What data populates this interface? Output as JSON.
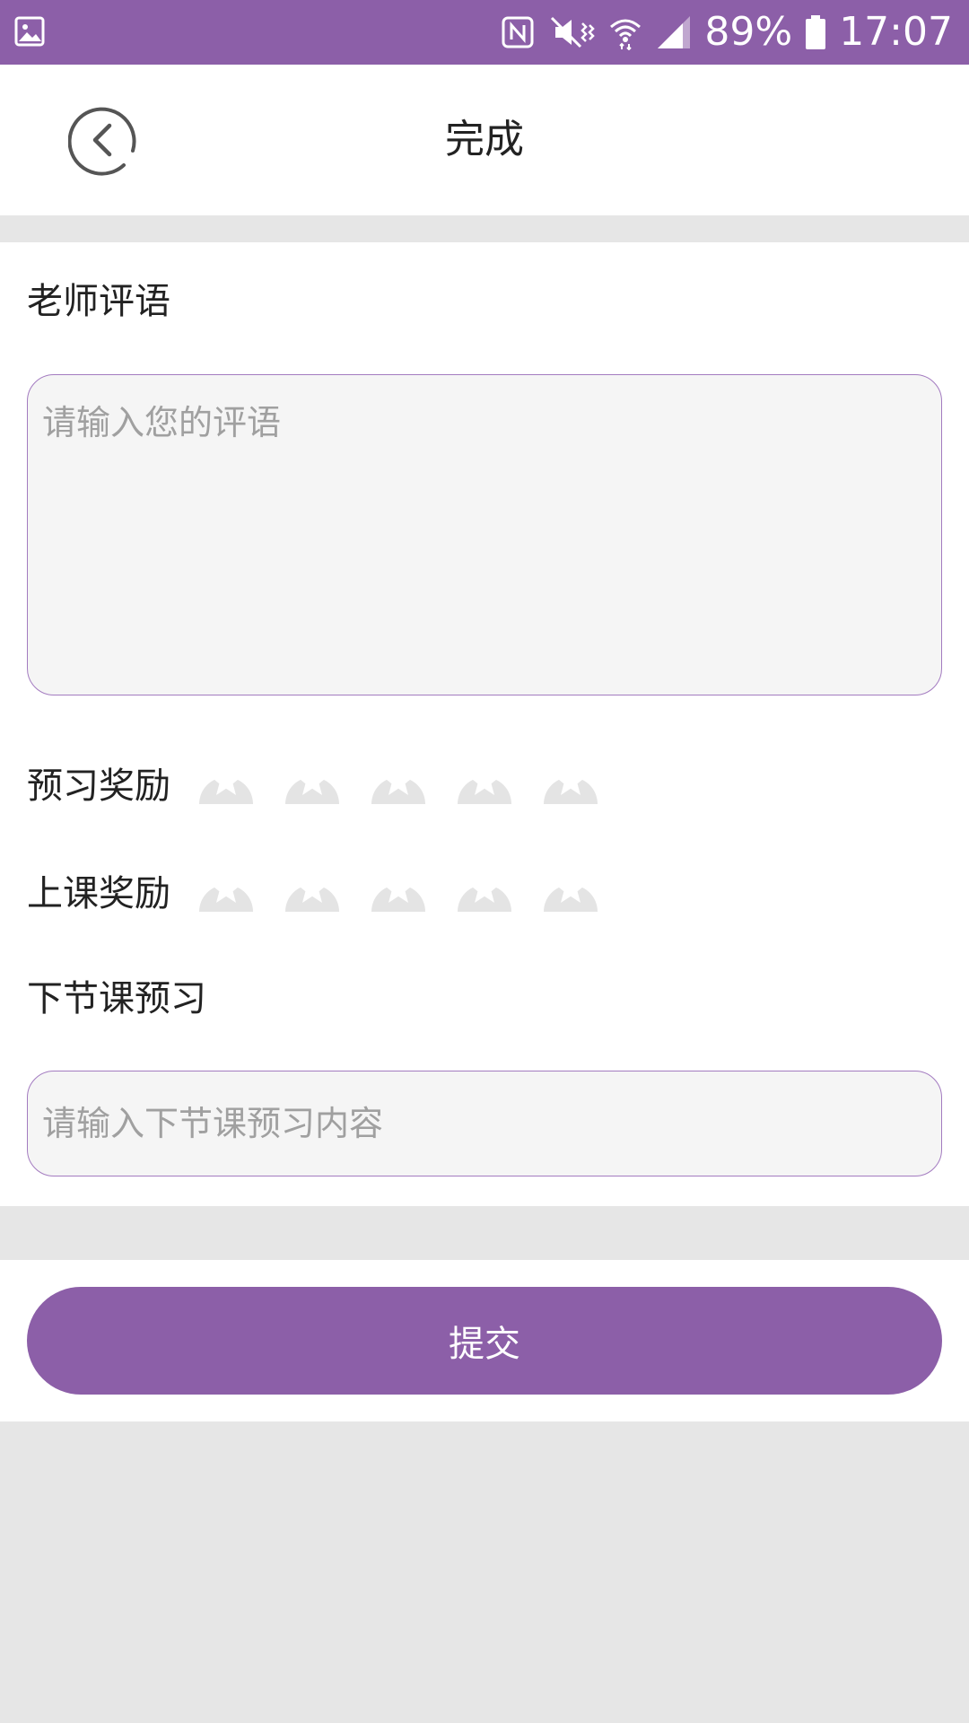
{
  "status_bar": {
    "battery_percent": "89%",
    "time": "17:07",
    "icons": [
      "gallery-icon",
      "nfc-icon",
      "mute-vibrate-icon",
      "wifi-icon",
      "signal-icon",
      "battery-icon"
    ]
  },
  "header": {
    "title": "完成",
    "back_icon": "chevron-left-circle-icon"
  },
  "form": {
    "comment_label": "老师评语",
    "comment_placeholder": "请输入您的评语",
    "preview_reward_label": "预习奖励",
    "preview_reward_rating": 0,
    "class_reward_label": "上课奖励",
    "class_reward_rating": 0,
    "max_stars": 5,
    "next_preview_label": "下节课预习",
    "next_preview_placeholder": "请输入下节课预习内容"
  },
  "submit": {
    "label": "提交"
  },
  "colors": {
    "accent": "#8c5fa8",
    "star_inactive": "#e4e4e4",
    "page_background": "#e6e6e6"
  }
}
